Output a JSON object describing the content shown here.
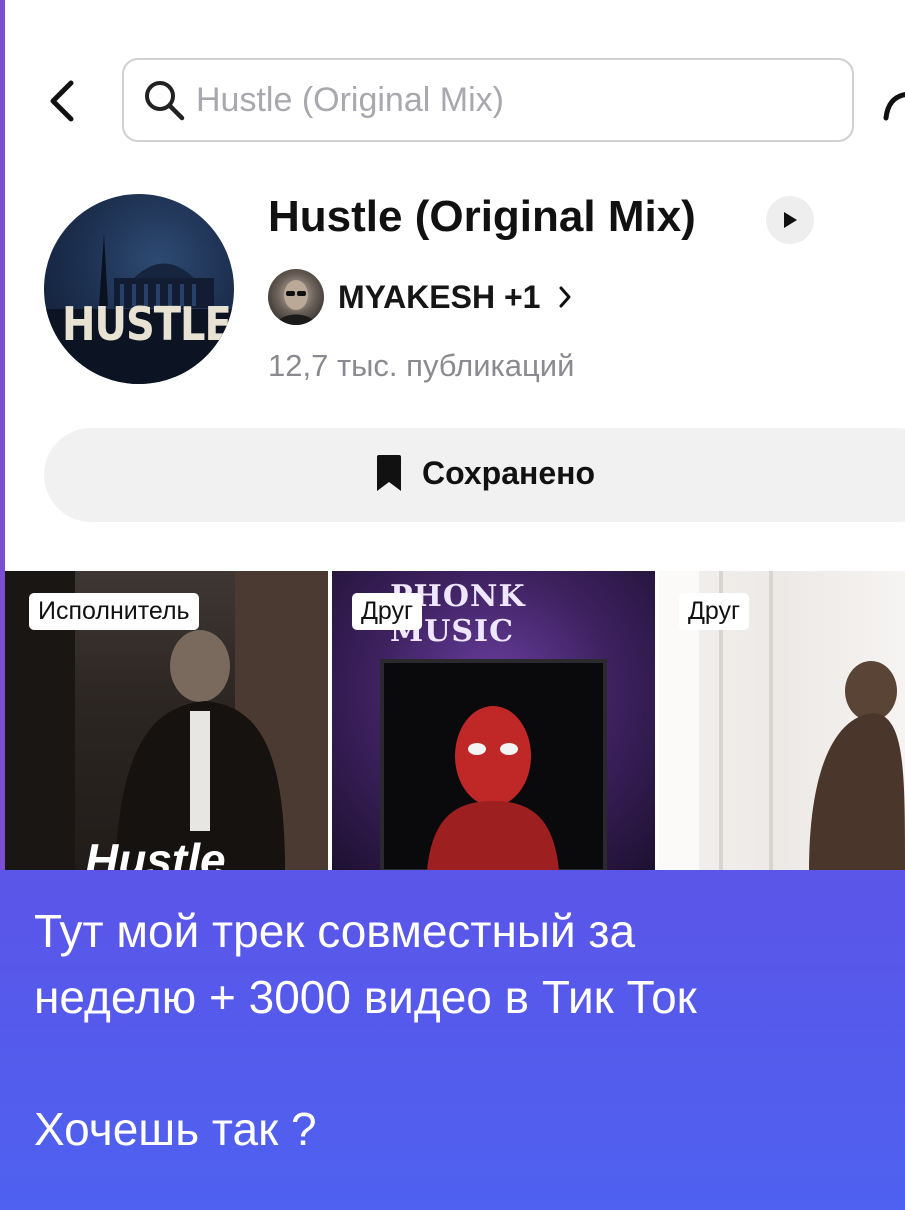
{
  "search": {
    "placeholder": "Hustle (Original Mix)"
  },
  "track": {
    "cover_text": "HUSTLE",
    "title": "Hustle (Original Mix)",
    "artist": "MYAKESH +1",
    "publications": "12,7 тыс. публикаций",
    "saved_label": "Сохранено"
  },
  "grid": {
    "tiles": [
      {
        "badge": "Исполнитель",
        "overlay": "Hustle"
      },
      {
        "badge": "Друг",
        "overlay": "PHONK MUSIC"
      },
      {
        "badge": "Друг"
      }
    ]
  },
  "promo": {
    "text": "Тут мой трек совместный за\nнеделю + 3000 видео в Тик Ток\n\nХочешь так ?"
  },
  "colors": {
    "promo_bg": "#5358ec",
    "accent_left_strip": "#7b4fd1"
  },
  "icons": [
    "back-arrow-icon",
    "search-icon",
    "share-icon",
    "play-icon",
    "chevron-right-icon",
    "bookmark-icon"
  ]
}
